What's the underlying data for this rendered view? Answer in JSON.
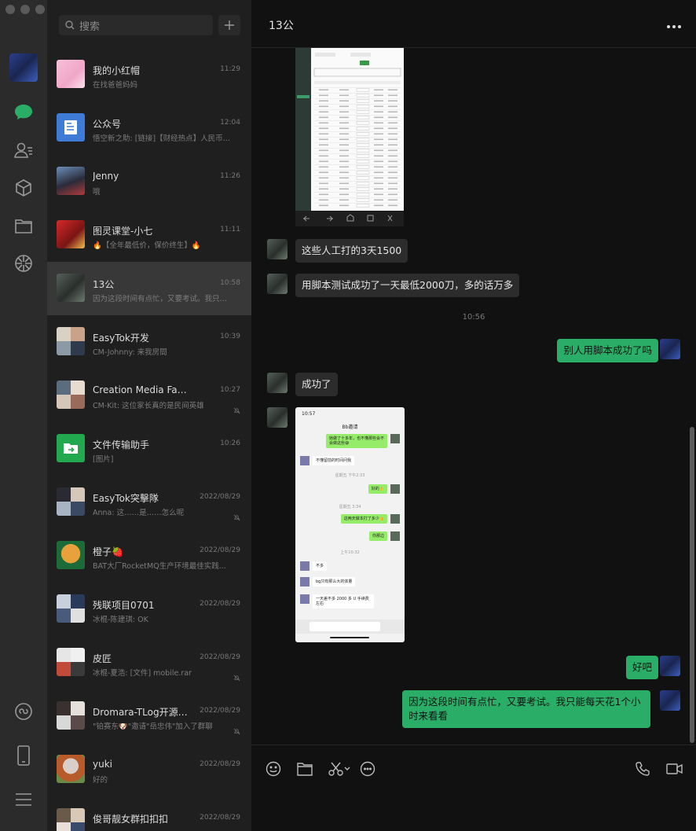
{
  "search": {
    "placeholder": "搜索"
  },
  "chats": [
    {
      "name": "我的小红帽",
      "time": "11:29",
      "preview": "在找爸爸妈妈",
      "muted": false
    },
    {
      "name": "公众号",
      "time": "12:04",
      "preview": "悟空新之助: [链接]【财经热点】人民币四...",
      "muted": false
    },
    {
      "name": "Jenny",
      "time": "11:26",
      "preview": "哦",
      "muted": false
    },
    {
      "name": "图灵课堂-小七",
      "time": "11:11",
      "preview": "🔥【全年最低价，保价终生】🔥",
      "muted": false
    },
    {
      "name": "13公",
      "time": "10:58",
      "preview": "因为这段时间有点忙，又要考试。我只能每...",
      "muted": false
    },
    {
      "name": "EasyTok开发",
      "time": "10:39",
      "preview": "CM-Johnny: 来我房間",
      "muted": false
    },
    {
      "name": "Creation Media Family",
      "time": "10:27",
      "preview": "CM-Kit: 这位家长真的是民间英雄",
      "muted": true
    },
    {
      "name": "文件传输助手",
      "time": "10:26",
      "preview": "[图片]",
      "muted": false
    },
    {
      "name": "EasyTok突擊隊",
      "time": "2022/08/29",
      "preview": "Anna: 这……是……怎么呢",
      "muted": true
    },
    {
      "name": "橙子🍓",
      "time": "2022/08/29",
      "preview": "BAT大厂RocketMQ生产环境最佳实践...",
      "muted": false
    },
    {
      "name": "残联项目0701",
      "time": "2022/08/29",
      "preview": "冰棍-陈建琪: OK",
      "muted": false
    },
    {
      "name": "皮匠",
      "time": "2022/08/29",
      "preview": "冰棍-夏浩: [文件] mobile.rar",
      "muted": true
    },
    {
      "name": "Dromara-TLog开源轻量...",
      "time": "2022/08/29",
      "preview": "\"铂赛东🐶\"邀请\"岳忠伟\"加入了群聊",
      "muted": true
    },
    {
      "name": "yuki",
      "time": "2022/08/29",
      "preview": "好的",
      "muted": false
    },
    {
      "name": "俊哥靓女群扣扣扣",
      "time": "2022/08/29",
      "preview": "",
      "muted": true
    }
  ],
  "chat": {
    "title": "13公",
    "messages": [
      {
        "side": "left",
        "text": "这些人工打的3天1500"
      },
      {
        "side": "left",
        "text": "用脚本测试成功了一天最低2000刀，多的话万多"
      },
      {
        "side": "right",
        "text": "别人用脚本成功了吗"
      },
      {
        "side": "left",
        "text": "成功了"
      },
      {
        "side": "right",
        "text": "好吧"
      },
      {
        "side": "right",
        "text": "因为这段时间有点忙，又要考试。我只能每天花1个小时来看看"
      }
    ],
    "timestamp": "10:56",
    "screenshot2": {
      "time": "10:57",
      "title": "Bb邀请",
      "lines": [
        {
          "side": "right",
          "text": "她做了十多年，也不懂那些会不会做这些😅"
        },
        {
          "side": "left",
          "text": "不懂留前的时间问我"
        },
        {
          "side": "center",
          "text": "星期五 下午2:33"
        },
        {
          "side": "right",
          "text": "好的👌"
        },
        {
          "side": "center",
          "text": "星期五 3:34"
        },
        {
          "side": "right",
          "text": "这两天做本打了多少👍"
        },
        {
          "side": "right",
          "text": "你那边"
        },
        {
          "side": "center",
          "text": "上午10:32"
        },
        {
          "side": "left",
          "text": "不多"
        },
        {
          "side": "left",
          "text": "bg只有那么大的体量"
        },
        {
          "side": "left",
          "text": "一天差不多 2000 多 U 手续费左右"
        }
      ]
    }
  },
  "colors": {
    "accent": "#2aae67",
    "bubble_left": "#2c2c2c",
    "bg": "#111111"
  }
}
